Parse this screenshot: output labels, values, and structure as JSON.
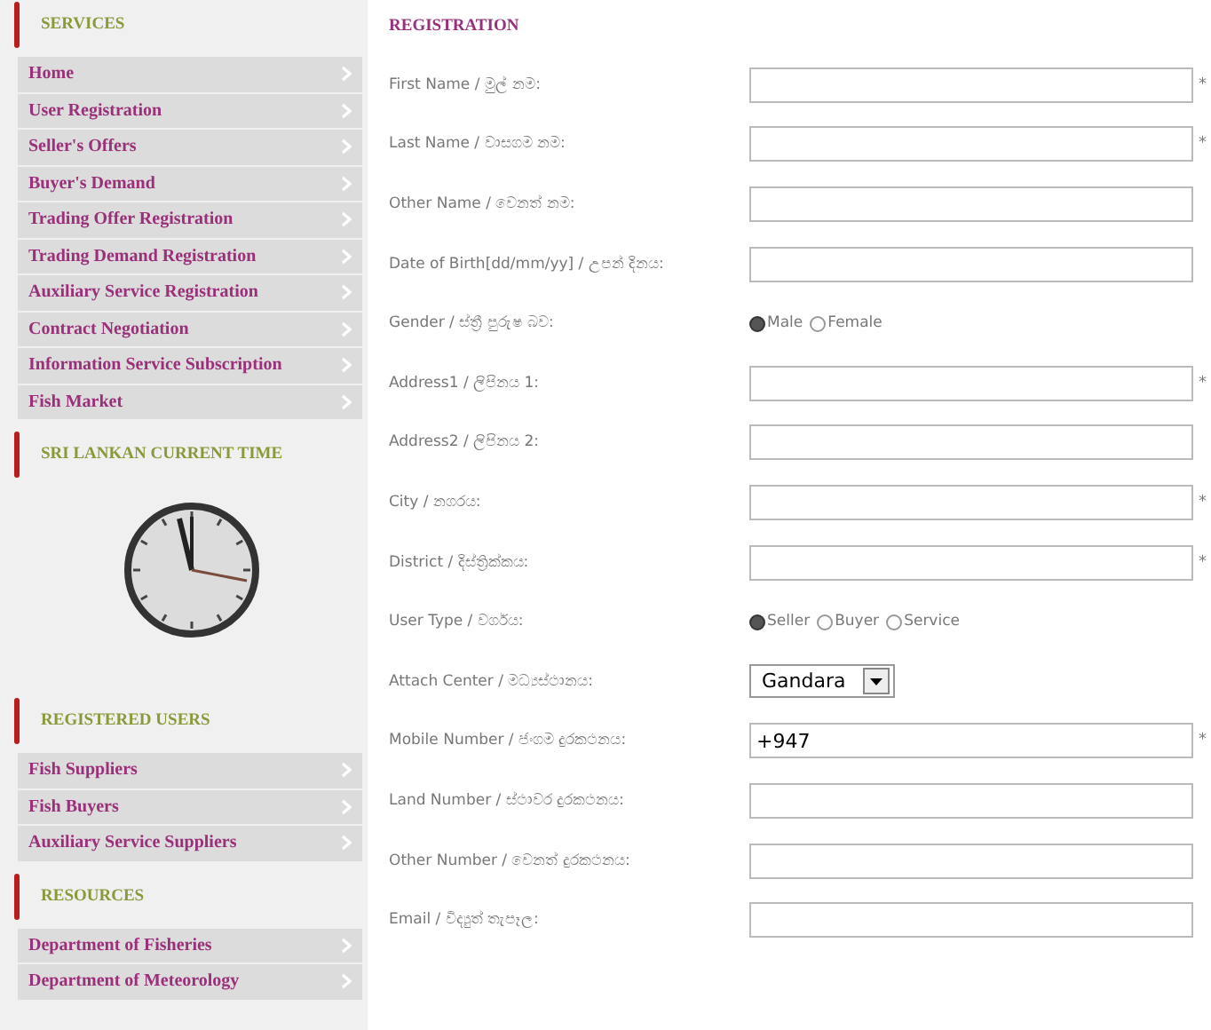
{
  "sidebar": {
    "sections": [
      {
        "title": "SERVICES",
        "kind": "menu",
        "items": [
          {
            "label": "Home"
          },
          {
            "label": "User Registration"
          },
          {
            "label": "Seller's Offers"
          },
          {
            "label": "Buyer's Demand"
          },
          {
            "label": "Trading Offer Registration"
          },
          {
            "label": "Trading Demand Registration"
          },
          {
            "label": "Auxiliary Service Registration"
          },
          {
            "label": "Contract Negotiation"
          },
          {
            "label": "Information Service Subscription"
          },
          {
            "label": "Fish Market"
          }
        ]
      },
      {
        "title": "SRI LANKAN CURRENT TIME",
        "kind": "clock"
      },
      {
        "title": "REGISTERED USERS",
        "kind": "menu",
        "items": [
          {
            "label": "Fish Suppliers"
          },
          {
            "label": "Fish Buyers"
          },
          {
            "label": "Auxiliary Service Suppliers"
          }
        ]
      },
      {
        "title": "RESOURCES",
        "kind": "menu",
        "items": [
          {
            "label": "Department of Fisheries"
          },
          {
            "label": "Department of Meteorology"
          }
        ]
      }
    ]
  },
  "form": {
    "title": "REGISTRATION",
    "rows": [
      {
        "kind": "text",
        "label": "First Name / මුල් නම:",
        "mark": "*"
      },
      {
        "kind": "text",
        "label": "Last Name / වාසගම නම:",
        "mark": "*"
      },
      {
        "kind": "text",
        "label": "Other Name / වෙනත් නම:"
      },
      {
        "kind": "text",
        "label": "Date of Birth[dd/mm/yy] / උපන් දිනය:"
      },
      {
        "kind": "radio",
        "label": "Gender / ස්ත්‍රී පුරුෂ බව:",
        "options": [
          {
            "label": "Male",
            "selected": true
          },
          {
            "label": "Female",
            "selected": false
          }
        ]
      },
      {
        "kind": "text",
        "label": "Address1 / ලිපිනය 1:",
        "mark": "*"
      },
      {
        "kind": "text",
        "label": "Address2 / ලිපිනය 2:"
      },
      {
        "kind": "text",
        "label": "City / නගරය:",
        "mark": "*"
      },
      {
        "kind": "text",
        "label": "District / දිස්ත්‍රික්කය:",
        "mark": "*"
      },
      {
        "kind": "radio",
        "label": "User Type / වර්ගය:",
        "options": [
          {
            "label": "Seller",
            "selected": true
          },
          {
            "label": "Buyer",
            "selected": false
          },
          {
            "label": "Service",
            "selected": false
          }
        ]
      },
      {
        "kind": "select",
        "label": "Attach Center / මධ්‍යස්ථානය:",
        "value": "Gandara"
      },
      {
        "kind": "text",
        "label": "Mobile Number / ජංගම දුරකථනය:",
        "value": "+947",
        "mark": "*"
      },
      {
        "kind": "text",
        "label": "Land Number / ස්ථාවර දුරකථනය:"
      },
      {
        "kind": "text",
        "label": "Other Number / වෙනත් දුරකථනය:"
      },
      {
        "kind": "text",
        "label": "Email / විද්‍යුත් තැපෑල:"
      }
    ]
  }
}
